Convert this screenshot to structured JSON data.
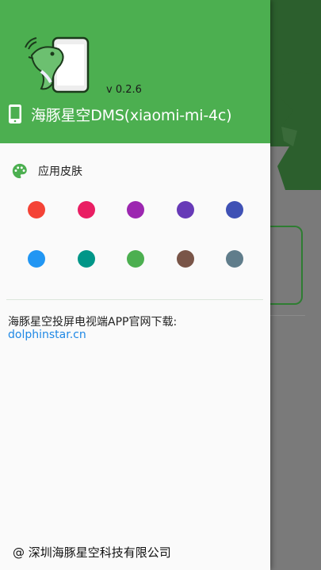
{
  "header": {
    "version": "v 0.2.6",
    "device_title": "海豚星空DMS(xiaomi-mi-4c)",
    "icons": {
      "logo": "dolphin-phone-logo",
      "device": "phone-icon"
    }
  },
  "skin": {
    "label": "应用皮肤",
    "icon": "palette-icon",
    "colors": [
      [
        "#f44336",
        "#e91e63",
        "#9c27b0",
        "#673ab7",
        "#3f51b5"
      ],
      [
        "#2196f3",
        "#009688",
        "#4caf50",
        "#795548",
        "#607d8b"
      ]
    ]
  },
  "download": {
    "text": "海豚星空投屏电视端APP官网下载:",
    "link": "dolphinstar.cn"
  },
  "footer": {
    "company": "@ 深圳海豚星空科技有限公司"
  },
  "colors": {
    "accent": "#4caf50",
    "link": "#1e88e5"
  }
}
